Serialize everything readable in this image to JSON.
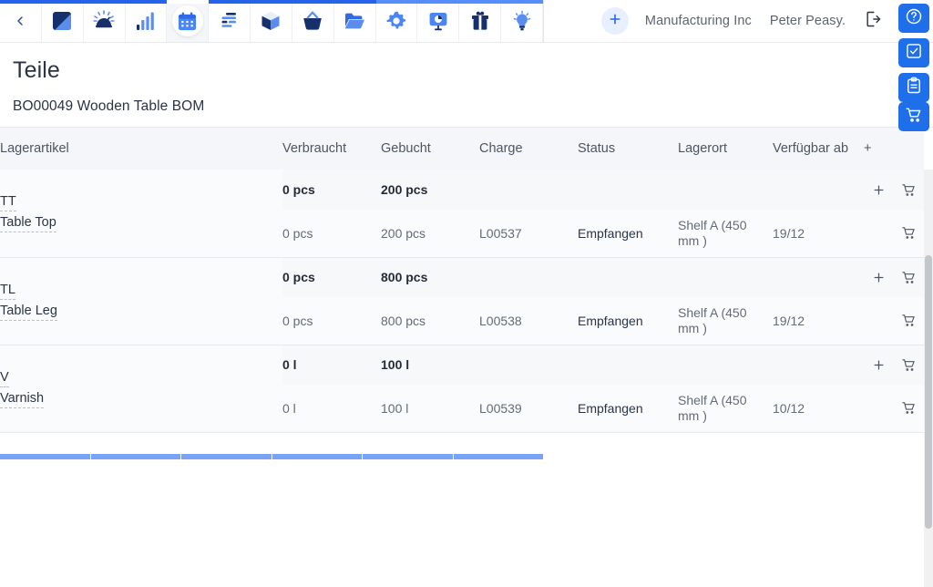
{
  "topnav": {
    "back_icon": "chevron-left-icon",
    "items": [
      {
        "name": "dashboard-square-icon",
        "label": "Dashboard",
        "active": false
      },
      {
        "name": "gauge-icon",
        "label": "Monitor",
        "active": false
      },
      {
        "name": "bar-chart-icon",
        "label": "Reports",
        "active": false
      },
      {
        "name": "calendar-icon",
        "label": "Planning",
        "active": true
      },
      {
        "name": "list-bars-icon",
        "label": "Orders",
        "active": false
      },
      {
        "name": "cube-icon",
        "label": "Inventory",
        "active": false
      },
      {
        "name": "basket-icon",
        "label": "Purchasing",
        "active": false
      },
      {
        "name": "folder-open-icon",
        "label": "Documents",
        "active": false
      },
      {
        "name": "gear-icon",
        "label": "Settings",
        "active": false
      },
      {
        "name": "presentation-chart-icon",
        "label": "Analytics",
        "active": false
      },
      {
        "name": "gift-icon",
        "label": "Whats New",
        "active": false
      },
      {
        "name": "lightbulb-icon",
        "label": "Ideas",
        "active": false
      }
    ],
    "add_button_icon": "plus-icon",
    "organization": "Manufacturing Inc",
    "user": "Peter Peasy.",
    "logout_icon": "logout-icon"
  },
  "rail": {
    "buttons": [
      {
        "name": "help-button",
        "icon": "question-circle-icon"
      },
      {
        "name": "tasks-button",
        "icon": "checkbox-icon"
      },
      {
        "name": "clipboard-button",
        "icon": "clipboard-icon"
      }
    ],
    "cart_button": {
      "name": "cart-button",
      "icon": "cart-icon"
    }
  },
  "page": {
    "title": "Teile",
    "subtitle": "BO00049 Wooden Table BOM"
  },
  "table": {
    "columns": {
      "item": "Lagerartikel",
      "used": "Verbraucht",
      "booked": "Gebucht",
      "batch": "Charge",
      "status": "Status",
      "location": "Lagerort",
      "available": "Verfügbar ab",
      "add": "+"
    },
    "groups": [
      {
        "code": "TT",
        "name": "Table Top",
        "summary": {
          "used": "0 pcs",
          "booked": "200 pcs",
          "batch": "",
          "status": "",
          "location": "",
          "available": ""
        },
        "details": [
          {
            "used": "0 pcs",
            "booked": "200 pcs",
            "batch": "L00537",
            "status": "Empfangen",
            "location": "Shelf A (450 mm )",
            "available": "19/12"
          }
        ]
      },
      {
        "code": "TL",
        "name": "Table Leg",
        "summary": {
          "used": "0 pcs",
          "booked": "800 pcs",
          "batch": "",
          "status": "",
          "location": "",
          "available": ""
        },
        "details": [
          {
            "used": "0 pcs",
            "booked": "800 pcs",
            "batch": "L00538",
            "status": "Empfangen",
            "location": "Shelf A (450 mm )",
            "available": "19/12"
          }
        ]
      },
      {
        "code": "V",
        "name": "Varnish",
        "summary": {
          "used": "0 l",
          "booked": "100 l",
          "batch": "",
          "status": "",
          "location": "",
          "available": ""
        },
        "details": [
          {
            "used": "0 l",
            "booked": "100 l",
            "batch": "L00539",
            "status": "Empfangen",
            "location": "Shelf A (450 mm )",
            "available": "10/12"
          }
        ]
      }
    ]
  },
  "colors": {
    "accent": "#2563eb",
    "accent_light": "#558dfa",
    "icon_dark": "#15306b",
    "icon_light": "#5b8def",
    "text": "#2b3445",
    "muted": "#626b78",
    "row_alt": "#f7f8fa"
  }
}
